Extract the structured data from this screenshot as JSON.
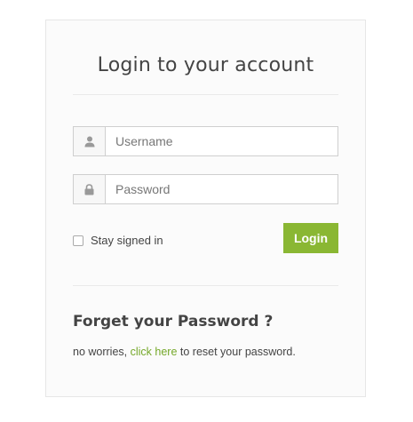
{
  "login": {
    "title": "Login to your account",
    "username_placeholder": "Username",
    "password_placeholder": "Password",
    "remember_label": "Stay signed in",
    "remember_checked": false,
    "submit_label": "Login"
  },
  "forgot": {
    "title": "Forget your Password ?",
    "text_before": "no worries, ",
    "link_text": "click here",
    "text_after": " to reset your password."
  },
  "colors": {
    "accent": "#8ab733",
    "link": "#75a82a"
  },
  "icons": {
    "username": "user-icon",
    "password": "lock-icon"
  }
}
